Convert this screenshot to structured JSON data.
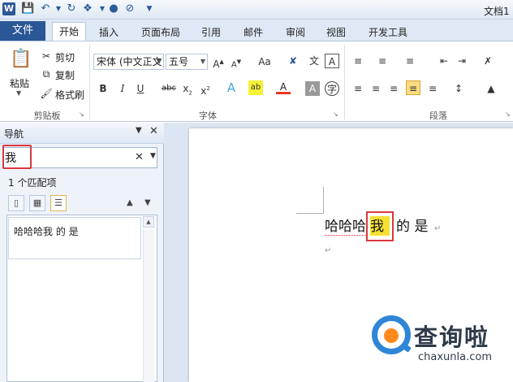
{
  "titlebar": {
    "app_logo": "W",
    "doc_title": "文档1"
  },
  "tabs": {
    "file": "文件",
    "home": "开始",
    "insert": "插入",
    "layout": "页面布局",
    "references": "引用",
    "mailings": "邮件",
    "review": "审阅",
    "view": "视图",
    "developer": "开发工具"
  },
  "ribbon": {
    "clipboard": {
      "paste": "粘贴",
      "cut": "剪切",
      "copy": "复制",
      "format_painter": "格式刷",
      "label": "剪贴板"
    },
    "font": {
      "font_name": "宋体 (中文正文)",
      "font_size": "五号",
      "label": "字体"
    },
    "paragraph": {
      "label": "段落"
    }
  },
  "nav": {
    "title": "导航",
    "search_value": "我",
    "match_count": "1 个匹配项",
    "results": [
      "哈哈哈我 的 是"
    ]
  },
  "document": {
    "before": "哈哈哈",
    "highlight": "我",
    "after": "的  是"
  },
  "watermark": {
    "name": "查询啦",
    "url": "chaxunla.com"
  },
  "colors": {
    "file_tab": "#2b5797",
    "highlight": "#f6e133",
    "annotation_red": "#d9383e",
    "watermark_blue": "#2f86d6",
    "watermark_orange": "#ff8a1c"
  }
}
